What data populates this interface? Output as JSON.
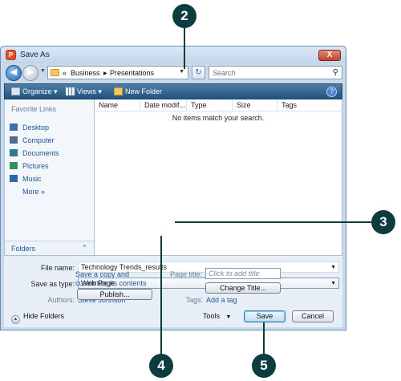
{
  "window": {
    "title": "Save As",
    "close_glyph": "X"
  },
  "address": {
    "overflow": "«",
    "crumbs": [
      "Business",
      "Presentations"
    ],
    "sep": "▶",
    "search_placeholder": "Search"
  },
  "toolbar": {
    "organize": "Organize",
    "views": "Views",
    "new_folder": "New Folder",
    "help": "?"
  },
  "nav": {
    "title": "Favorite Links",
    "links": [
      "Desktop",
      "Computer",
      "Documents",
      "Pictures",
      "Music"
    ],
    "more": "More",
    "more_glyph": "»",
    "folders": "Folders",
    "folders_chev": "⌃"
  },
  "filelist": {
    "columns": [
      "Name",
      "Date modif...",
      "Type",
      "Size",
      "Tags"
    ],
    "empty": "No items match your search."
  },
  "form": {
    "file_name_label": "File name:",
    "file_name_value": "Technology Trends_results",
    "type_label": "Save as type:",
    "type_value": "Web Page",
    "authors_label": "Authors:",
    "authors_value": "Steve Johnson",
    "tags_label": "Tags:",
    "tags_value": "Add a tag",
    "copy_text_1": "Save a copy and",
    "copy_text_2": "customize its contents",
    "publish": "Publish...",
    "page_title_label": "Page title:",
    "page_title_placeholder": "Click to add title",
    "change_title": "Change Title..."
  },
  "footer": {
    "hide_folders": "Hide Folders",
    "tools": "Tools",
    "save": "Save",
    "cancel": "Cancel"
  },
  "callouts": [
    "2",
    "3",
    "4",
    "5"
  ]
}
